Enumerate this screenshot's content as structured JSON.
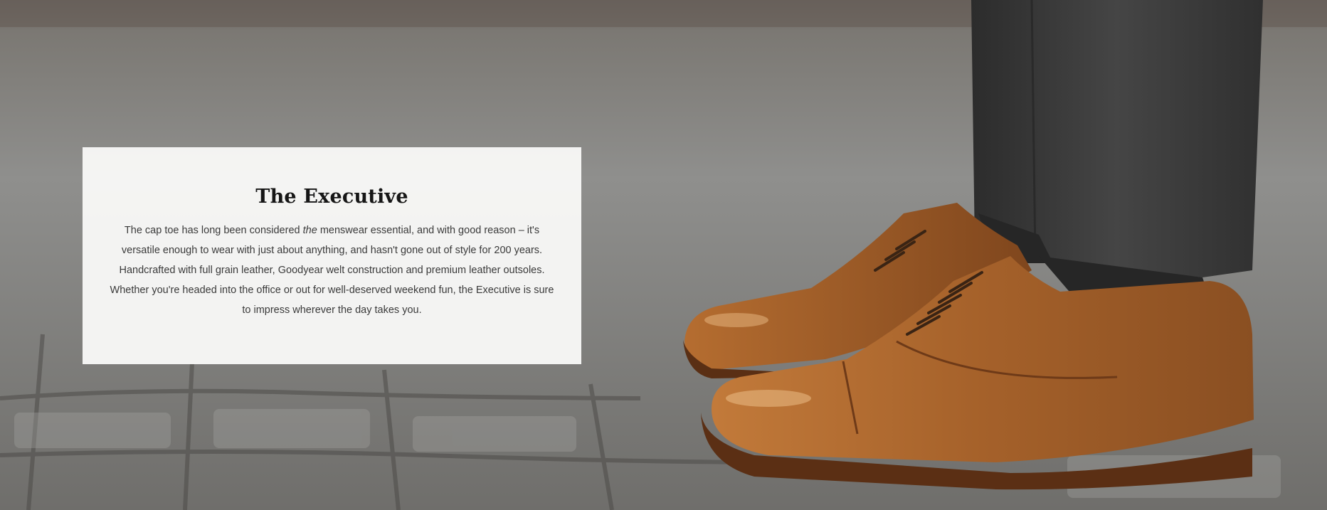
{
  "hero": {
    "image": "brown-leather-cap-toe-oxford-shoes-on-cobblestone",
    "colors": {
      "panel": "#f8f8f7",
      "heading": "#161616",
      "body_text": "#3a3a3a",
      "leather": "#a8652b",
      "trousers": "#3a3a3a"
    }
  },
  "card": {
    "title": "The Executive",
    "body_pre": "The cap toe has long been considered ",
    "body_em": "the",
    "body_post": " menswear essential, and with good reason – it's versatile enough to wear with just about anything, and hasn't gone out of style for 200 years. Handcrafted with full grain leather, Goodyear welt construction and premium leather outsoles. Whether you're headed into the office or out for well-deserved weekend fun, the Executive is sure to impress wherever the day takes you."
  }
}
